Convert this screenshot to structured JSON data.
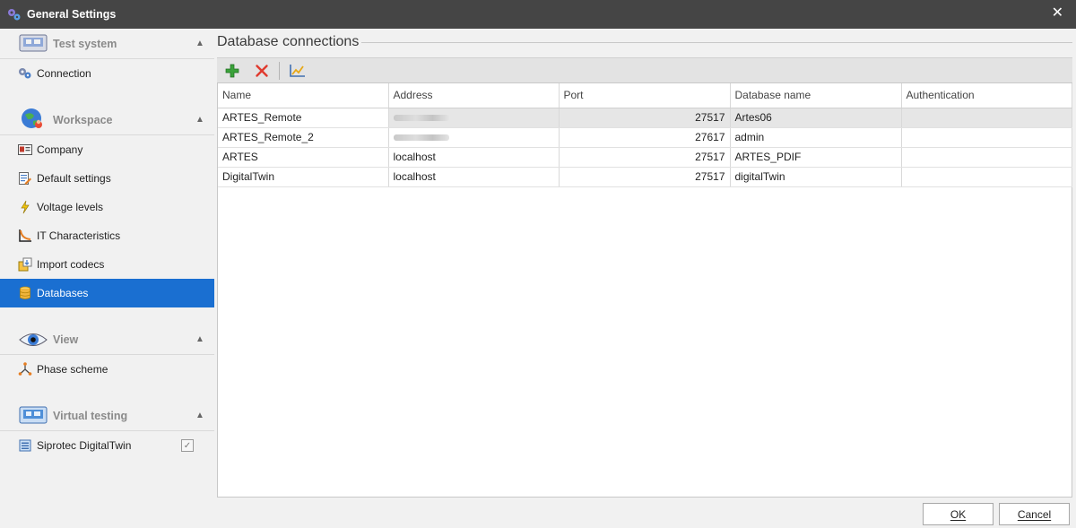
{
  "window": {
    "title": "General Settings"
  },
  "sidebar": {
    "groups": [
      {
        "label": "Test system",
        "items": [
          {
            "label": "Connection"
          }
        ]
      },
      {
        "label": "Workspace",
        "items": [
          {
            "label": "Company"
          },
          {
            "label": "Default settings"
          },
          {
            "label": "Voltage levels"
          },
          {
            "label": "IT Characteristics"
          },
          {
            "label": "Import codecs"
          },
          {
            "label": "Databases",
            "selected": true
          }
        ]
      },
      {
        "label": "View",
        "items": [
          {
            "label": "Phase scheme"
          }
        ]
      },
      {
        "label": "Virtual testing",
        "items": [
          {
            "label": "Siprotec DigitalTwin",
            "checked": true
          }
        ]
      }
    ]
  },
  "main": {
    "section_title": "Database connections",
    "toolbar": {
      "add_icon": "plus-icon",
      "delete_icon": "x-icon",
      "edit_icon": "chart-edit-icon"
    },
    "table": {
      "columns": [
        "Name",
        "Address",
        "Port",
        "Database name",
        "Authentication"
      ],
      "rows": [
        {
          "name": "ARTES_Remote",
          "address": "",
          "port": "27517",
          "database": "Artes06",
          "auth": ""
        },
        {
          "name": "ARTES_Remote_2",
          "address": "",
          "port": "27617",
          "database": "admin",
          "auth": ""
        },
        {
          "name": "ARTES",
          "address": "localhost",
          "port": "27517",
          "database": "ARTES_PDIF",
          "auth": ""
        },
        {
          "name": "DigitalTwin",
          "address": "localhost",
          "port": "27517",
          "database": "digitalTwin",
          "auth": ""
        }
      ]
    }
  },
  "buttons": {
    "ok": "OK",
    "cancel": "Cancel"
  },
  "colors": {
    "titlebar": "#454545",
    "selection": "#1a6fd1",
    "add_green": "#3aa23a",
    "delete_red": "#e03a2e"
  }
}
